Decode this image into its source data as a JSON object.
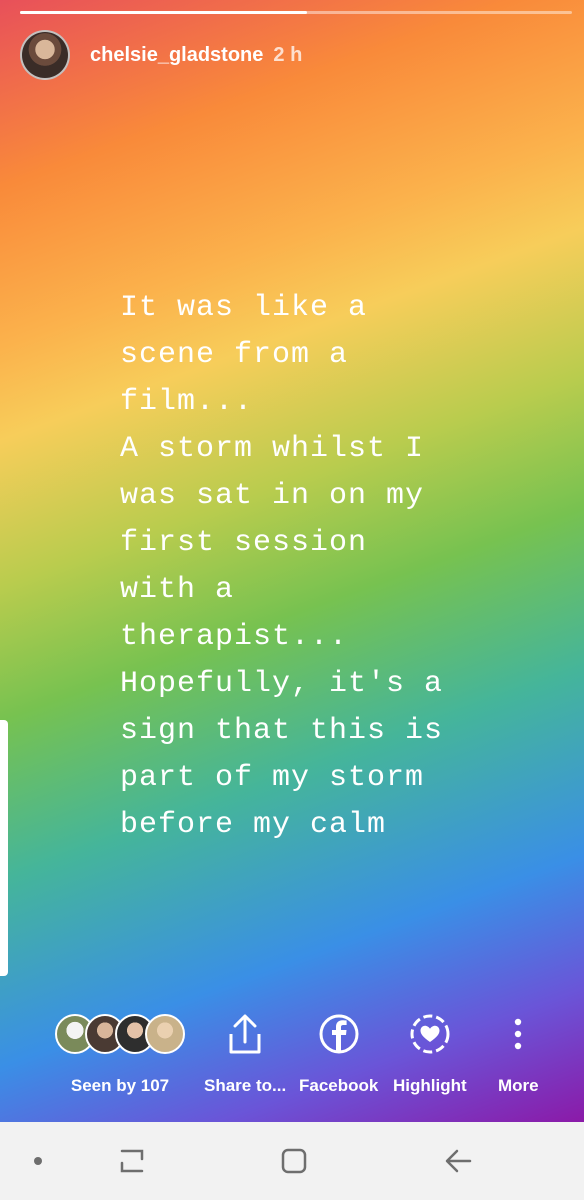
{
  "story": {
    "progress": 0.52,
    "username": "chelsie_gladstone",
    "time": "2 h",
    "text": "It was like a\nscene from a\nfilm...\nA storm whilst I\nwas sat in on my\nfirst session\nwith a\ntherapist...\nHopefully, it's a\nsign that this is\npart of my storm\nbefore my calm"
  },
  "actions": {
    "seen_by": "Seen by 107",
    "share": "Share to...",
    "facebook": "Facebook",
    "highlight": "Highlight",
    "more": "More"
  },
  "icons": {
    "share": "share-icon",
    "facebook": "facebook-icon",
    "highlight": "highlight-heart-icon",
    "more": "more-vertical-icon"
  },
  "colors": {
    "nav_background": "#f2f2f2",
    "nav_icon": "#6e6e6e"
  }
}
